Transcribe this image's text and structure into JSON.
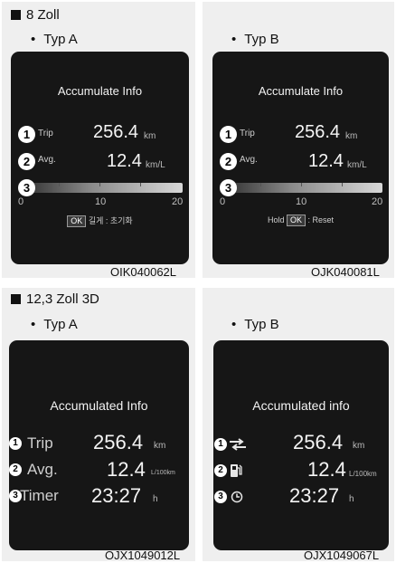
{
  "section1": {
    "heading": "8 Zoll",
    "typA": {
      "bullet": "Typ A",
      "title": "Accumulate Info",
      "rows": [
        {
          "num": "1",
          "label": "Trip",
          "value": "256.4",
          "unit": "km"
        },
        {
          "num": "2",
          "label": "Avg.",
          "value": "12.4",
          "unit": "km/L"
        }
      ],
      "bar_num": "3",
      "scale": [
        "0",
        "10",
        "20"
      ],
      "ok_label": "OK",
      "ok_text": "길게 : 초기화",
      "code": "OIK040062L"
    },
    "typB": {
      "bullet": "Typ B",
      "title": "Accumulate Info",
      "rows": [
        {
          "num": "1",
          "label": "Trip",
          "value": "256.4",
          "unit": "km"
        },
        {
          "num": "2",
          "label": "Avg.",
          "value": "12.4",
          "unit": "km/L"
        }
      ],
      "bar_num": "3",
      "scale": [
        "0",
        "10",
        "20"
      ],
      "ok_prefix": "Hold",
      "ok_label": "OK",
      "ok_text": ": Reset",
      "code": "OJK040081L"
    }
  },
  "section2": {
    "heading": "12,3 Zoll 3D",
    "typA": {
      "bullet": "Typ A",
      "title": "Accumulated Info",
      "rows": [
        {
          "num": "1",
          "label": "Trip",
          "value": "256.4",
          "unit": "km"
        },
        {
          "num": "2",
          "label": "Avg.",
          "value": "12.4",
          "unit": "L/100km"
        },
        {
          "num": "3",
          "label": "Timer",
          "value": "23:27",
          "unit": "h"
        }
      ],
      "code": "OJX1049012L"
    },
    "typB": {
      "bullet": "Typ B",
      "title": "Accumulated info",
      "rows": [
        {
          "num": "1",
          "icon": "trip-arrows-icon",
          "value": "256.4",
          "unit": "km"
        },
        {
          "num": "2",
          "icon": "fuel-pump-icon",
          "value": "12.4",
          "unit": "L/100km"
        },
        {
          "num": "3",
          "icon": "clock-icon",
          "value": "23:27",
          "unit": "h"
        }
      ],
      "code": "OJX1049067L"
    }
  },
  "bullet_char": "•",
  "colors": {
    "panel_bg": "#efefef",
    "screen_bg": "#161616",
    "text": "#1a1a1a"
  }
}
